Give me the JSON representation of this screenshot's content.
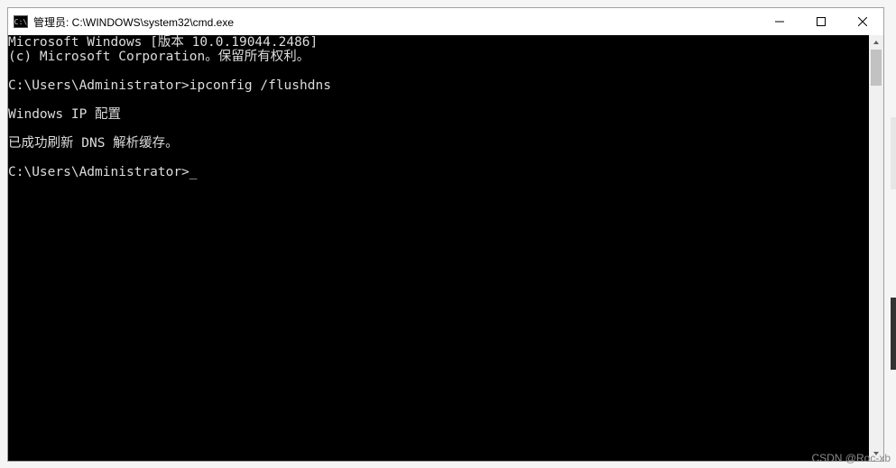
{
  "window": {
    "title": "管理员: C:\\WINDOWS\\system32\\cmd.exe",
    "icon_glyph": "C:\\"
  },
  "terminal": {
    "line1": "Microsoft Windows [版本 10.0.19044.2486]",
    "line2": "(c) Microsoft Corporation。保留所有权利。",
    "blank1": "",
    "prompt1_path": "C:\\Users\\Administrator>",
    "prompt1_cmd": "ipconfig /flushdns",
    "blank2": "",
    "output1": "Windows IP 配置",
    "blank3": "",
    "output2": "已成功刷新 DNS 解析缓存。",
    "blank4": "",
    "prompt2_path": "C:\\Users\\Administrator>",
    "cursor": "_"
  },
  "watermark": "CSDN @Roc-xb"
}
